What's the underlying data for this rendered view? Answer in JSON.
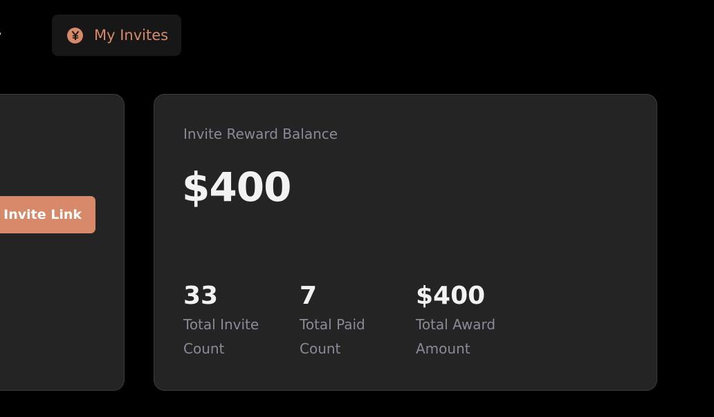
{
  "tabs": {
    "history_label": "tory",
    "invites_label": "My Invites",
    "invites_icon": "yen-coin-icon"
  },
  "left_card": {
    "button_label": "y Invite Link"
  },
  "reward": {
    "title": "Invite Reward Balance",
    "balance": "$400",
    "stats": [
      {
        "value": "33",
        "label_line1": "Total Invite",
        "label_line2": "Count"
      },
      {
        "value": "7",
        "label_line1": "Total Paid",
        "label_line2": "Count"
      },
      {
        "value": "$400",
        "label_line1": "Total Award",
        "label_line2": "Amount"
      }
    ]
  },
  "colors": {
    "accent": "#d7896a",
    "background": "#000000",
    "card": "#242424",
    "muted_text": "#8a8a98"
  }
}
